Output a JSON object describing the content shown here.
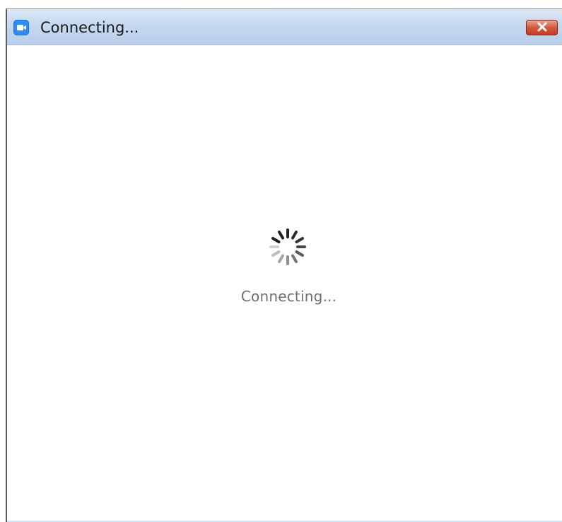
{
  "window": {
    "title": "Connecting...",
    "app_icon": "zoom-camera-icon",
    "close_icon": "close-icon",
    "close_button_color": "#c94a31"
  },
  "content": {
    "status_text": "Connecting...",
    "spinner_icon": "loading-spinner-icon"
  }
}
